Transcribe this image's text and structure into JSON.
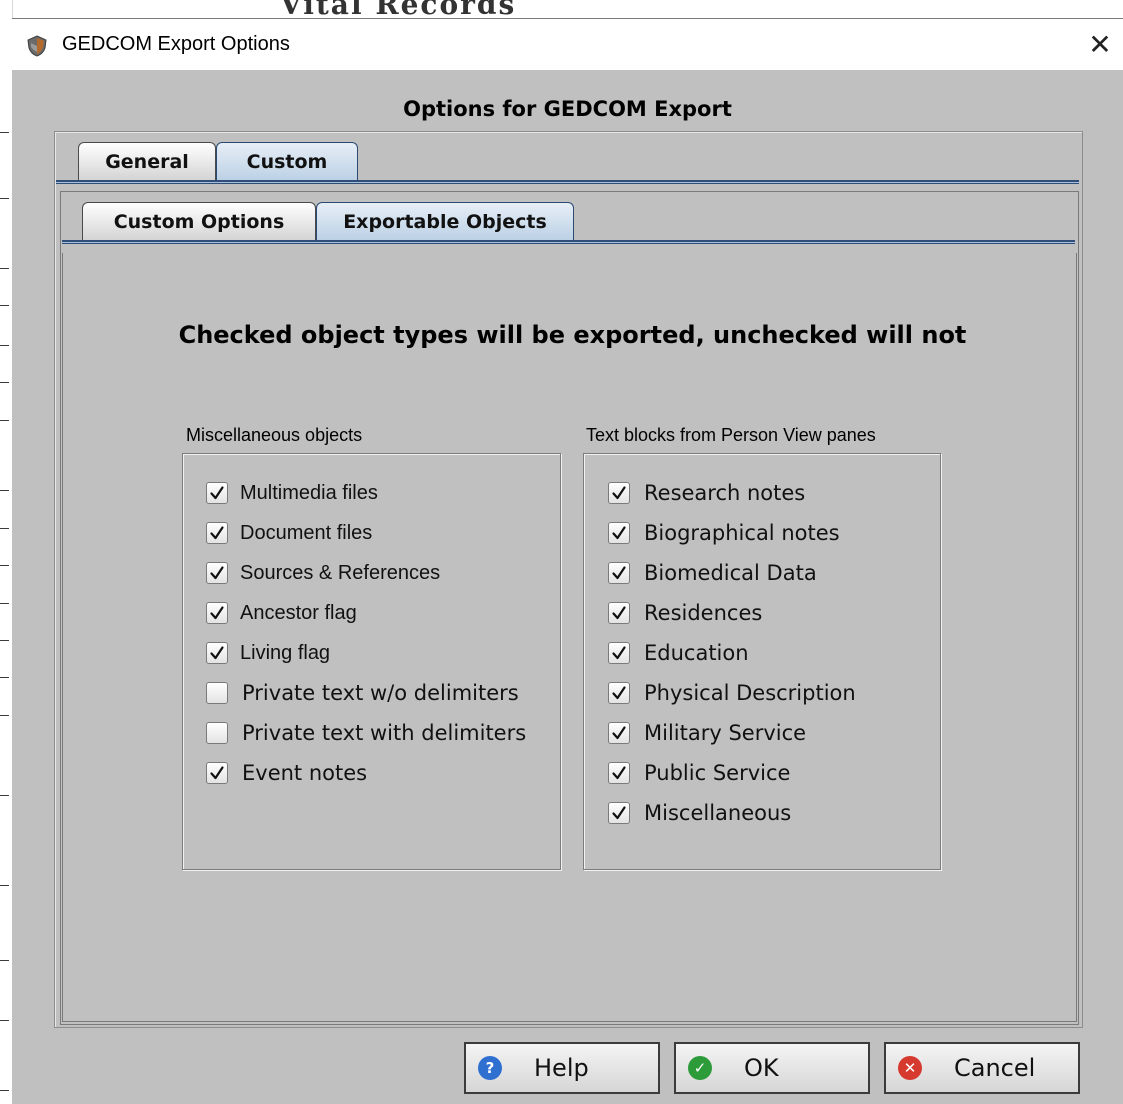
{
  "window": {
    "title": "GEDCOM Export Options",
    "close_glyph": "✕"
  },
  "heading": "Options for GEDCOM Export",
  "tabs_top": [
    {
      "label": "General",
      "active": false
    },
    {
      "label": "Custom",
      "active": true
    }
  ],
  "tabs_sub": [
    {
      "label": "Custom Options",
      "active": false
    },
    {
      "label": "Exportable Objects",
      "active": true
    }
  ],
  "instruction": "Checked object types will be exported, unchecked will not",
  "misc_group": {
    "label": "Miscellaneous objects",
    "items": [
      {
        "label": "Multimedia files",
        "checked": true
      },
      {
        "label": "Document files",
        "checked": true
      },
      {
        "label": "Sources & References",
        "checked": true
      },
      {
        "label": "Ancestor flag",
        "checked": true
      },
      {
        "label": "Living flag",
        "checked": true
      },
      {
        "label": "Private text w/o delimiters",
        "checked": false
      },
      {
        "label": "Private text with delimiters",
        "checked": false
      },
      {
        "label": "Event notes",
        "checked": true
      }
    ]
  },
  "text_group": {
    "label": "Text blocks from Person View panes",
    "items": [
      {
        "label": "Research notes",
        "checked": true
      },
      {
        "label": "Biographical notes",
        "checked": true
      },
      {
        "label": "Biomedical Data",
        "checked": true
      },
      {
        "label": "Residences",
        "checked": true
      },
      {
        "label": "Education",
        "checked": true
      },
      {
        "label": "Physical Description",
        "checked": true
      },
      {
        "label": "Military Service",
        "checked": true
      },
      {
        "label": "Public Service",
        "checked": true
      },
      {
        "label": "Miscellaneous",
        "checked": true
      }
    ]
  },
  "buttons": {
    "help": {
      "label": "Help",
      "icon": "help-icon",
      "color": "#2f6fd0",
      "glyph": "?"
    },
    "ok": {
      "label": "OK",
      "icon": "check-circle-icon",
      "color": "#2e9b3a",
      "glyph": "✓"
    },
    "cancel": {
      "label": "Cancel",
      "icon": "cancel-circle-icon",
      "color": "#d63a2f",
      "glyph": "✕"
    }
  },
  "background": {
    "fragment_text": "Vital Records"
  }
}
